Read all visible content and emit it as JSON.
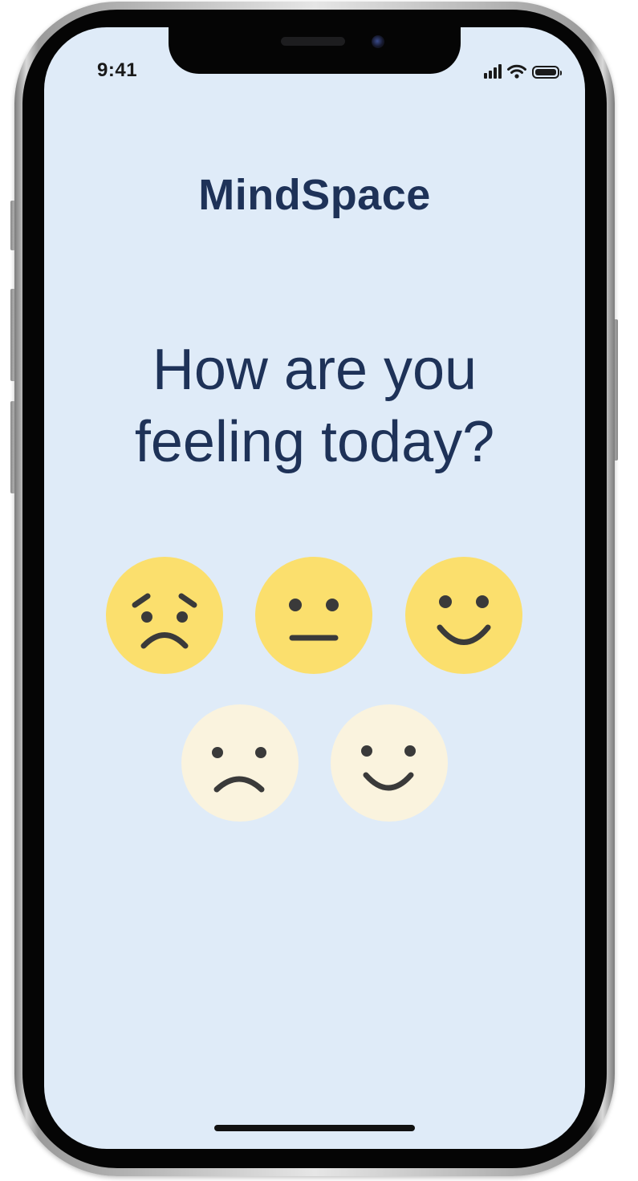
{
  "status_bar": {
    "time": "9:41",
    "icons": [
      "cellular-signal-icon",
      "wifi-icon",
      "battery-icon"
    ]
  },
  "app": {
    "title": "MindSpace"
  },
  "prompt": {
    "line1": "How are you",
    "line2": "feeling today?"
  },
  "moods": [
    {
      "icon": "worried-face-icon",
      "color": "#fbdf6d"
    },
    {
      "icon": "neutral-face-icon",
      "color": "#fbdf6d"
    },
    {
      "icon": "smiling-face-icon",
      "color": "#fbdf6d"
    },
    {
      "icon": "frowning-face-icon",
      "color": "#faf3de"
    },
    {
      "icon": "smiling-face-icon",
      "color": "#faf3de"
    }
  ],
  "colors": {
    "screen_background": "#dfebf8",
    "text_primary": "#1e3258",
    "face_features": "#3a3a3a"
  }
}
